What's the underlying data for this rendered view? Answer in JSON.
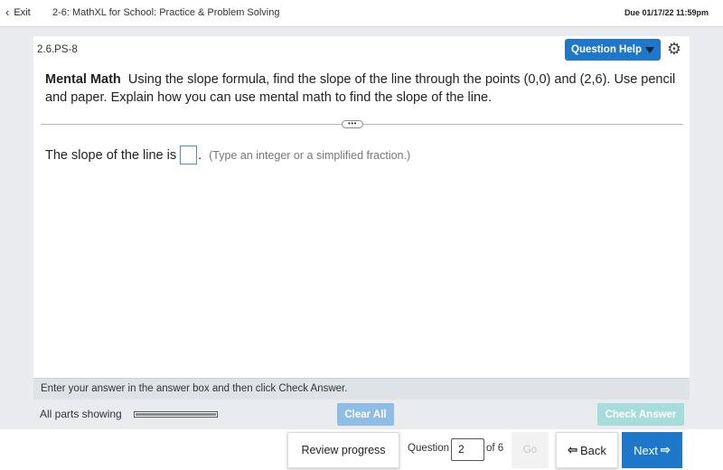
{
  "topbar": {
    "exit_label": "Exit",
    "course_title": "2-6: MathXL for School: Practice & Problem Solving",
    "due": "Due 01/17/22 11:59pm"
  },
  "question_header": {
    "id": "2.6.PS-8",
    "help_label": "Question Help"
  },
  "question": {
    "lead": "Mental Math",
    "text": "Using the slope formula, find the slope of the line through the points (0,0) and (2,6). Use pencil and paper. Explain how you can use mental math to find the slope of the line."
  },
  "expand_dots": "•••",
  "answer": {
    "prefix": "The slope of the line is",
    "value": "",
    "suffix": ".",
    "hint": "(Type an integer or a simplified fraction.)"
  },
  "instruction": "Enter your answer in the answer box and then click Check Answer.",
  "parts": {
    "label": "All parts showing",
    "progress_fraction": 1.0
  },
  "buttons": {
    "clear_all": "Clear All",
    "check_answer": "Check Answer",
    "review_progress": "Review progress",
    "go": "Go",
    "back": "Back",
    "next": "Next"
  },
  "nav": {
    "question_label": "Question",
    "current": "2",
    "of_total": "of 6"
  },
  "icons": {
    "exit_chevron": "‹",
    "gear": "⚙",
    "back_arrow": "🡠",
    "next_arrow": "🡢"
  },
  "colors": {
    "accent": "#1f77c9",
    "clear_disabled": "#8fbde6",
    "check_disabled": "#a6dcd9"
  }
}
